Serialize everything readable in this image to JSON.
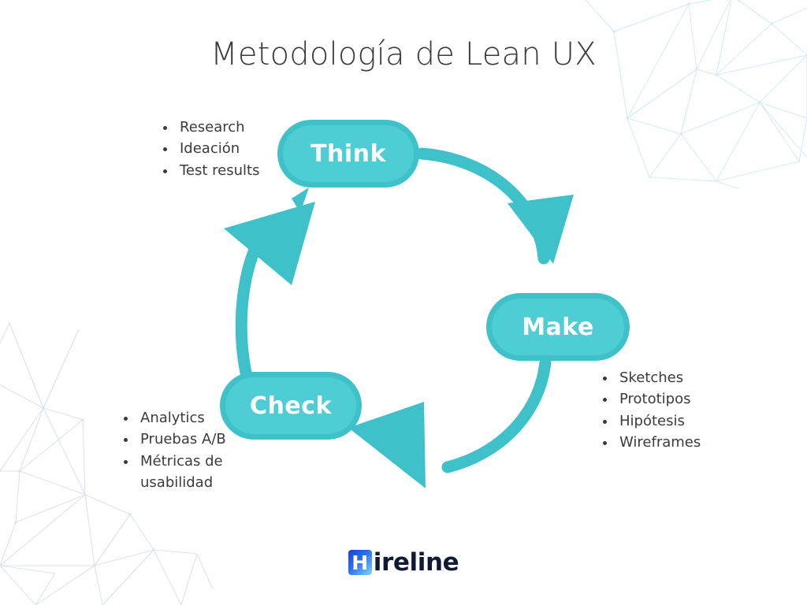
{
  "title": "Metodología de Lean UX",
  "colors": {
    "teal": "#3fc1c9",
    "teal_light": "#4ecdd4",
    "text": "#3b3b3b",
    "mesh_blue": "#d9edf5",
    "mesh_grey": "#dde3ee",
    "logo_dark": "#101a33"
  },
  "stages": {
    "think": {
      "label": "Think"
    },
    "make": {
      "label": "Make"
    },
    "check": {
      "label": "Check"
    }
  },
  "lists": {
    "think": [
      "Research",
      "Ideación",
      "Test results"
    ],
    "make": [
      "Sketches",
      "Prototipos",
      "Hipótesis",
      "Wireframes"
    ],
    "check": [
      "Analytics",
      "Pruebas A/B",
      "Métricas de usabilidad"
    ]
  },
  "logo": {
    "badge_letter": "H",
    "word": "ireline"
  }
}
